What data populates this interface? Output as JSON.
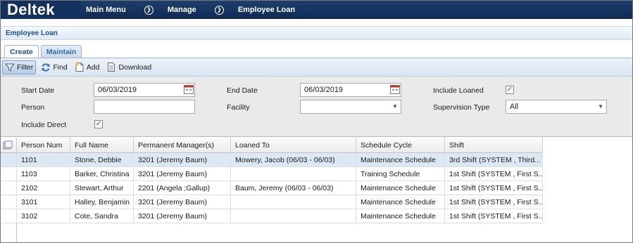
{
  "app": {
    "logo": "Deltek"
  },
  "nav": {
    "items": [
      "Main Menu",
      "Manage",
      "Employee Loan"
    ],
    "separator_icon": "circle-chevron-right-icon"
  },
  "page": {
    "title": "Employee Loan"
  },
  "tabs": [
    {
      "label": "Create",
      "active": true
    },
    {
      "label": "Maintain",
      "active": false
    }
  ],
  "toolbar": {
    "filter": "Filter",
    "find": "Find",
    "add": "Add",
    "download": "Download"
  },
  "filters": {
    "start_date": {
      "label": "Start Date",
      "value": "06/03/2019"
    },
    "end_date": {
      "label": "End Date",
      "value": "06/03/2019"
    },
    "include_loaned": {
      "label": "Include Loaned",
      "checked": true
    },
    "person": {
      "label": "Person",
      "value": ""
    },
    "facility": {
      "label": "Facility",
      "value": ""
    },
    "supervision_type": {
      "label": "Supervision Type",
      "value": "All"
    },
    "include_direct": {
      "label": "Include Direct",
      "checked": true
    }
  },
  "grid": {
    "columns": [
      "Person Num",
      "Full Name",
      "Permanent Manager(s)",
      "Loaned To",
      "Schedule Cycle",
      "Shift"
    ],
    "rows": [
      [
        "1101",
        "Stone, Debbie",
        "3201 (Jeremy  Baum)",
        "Mowery, Jacob (06/03 - 06/03)",
        "Maintenance Schedule",
        "3rd Shift (SYSTEM , Third..."
      ],
      [
        "1103",
        "Barker, Christina",
        "3201 (Jeremy  Baum)",
        "",
        "Training Schedule",
        "1st Shift (SYSTEM , First S..."
      ],
      [
        "2102",
        "Stewart, Arthur",
        "2201 (Angela ;Gallup)",
        "Baum, Jeremy (06/03 - 06/03)",
        "Maintenance Schedule",
        "1st Shift (SYSTEM , First S..."
      ],
      [
        "3101",
        "Halley, Benjamin",
        "3201 (Jeremy  Baum)",
        "",
        "Maintenance Schedule",
        "1st Shift (SYSTEM , First S..."
      ],
      [
        "3102",
        "Cote, Sandra",
        "3201 (Jeremy  Baum)",
        "",
        "Maintenance Schedule",
        "1st Shift (SYSTEM , First S..."
      ]
    ],
    "selected_row": 0
  }
}
